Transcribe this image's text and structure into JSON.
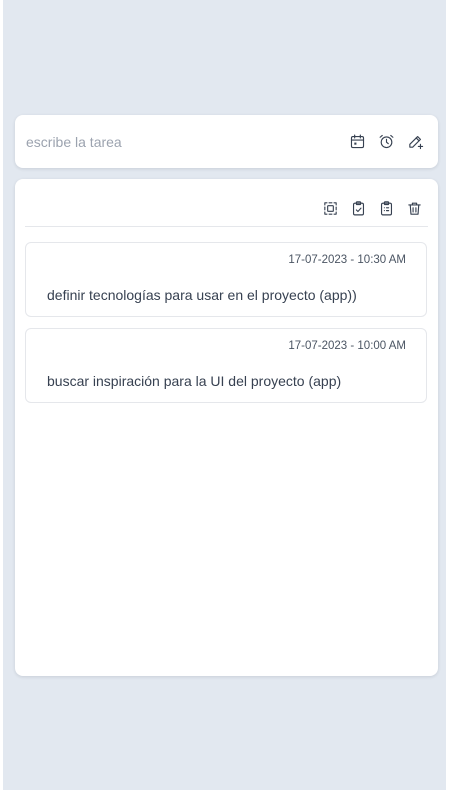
{
  "input": {
    "placeholder": "escribe la tarea",
    "value": "",
    "icons": [
      "calendar-icon",
      "alarm-clock-icon",
      "pen-plus-icon"
    ]
  },
  "toolbar": {
    "icons": [
      "select-all-icon",
      "clipboard-check-icon",
      "clipboard-list-icon",
      "trash-icon"
    ]
  },
  "tasks": [
    {
      "date": "17-07-2023 - 10:30 AM",
      "text": "definir tecnologías para usar en el proyecto (app))"
    },
    {
      "date": "17-07-2023 - 10:00 AM",
      "text": "buscar inspiración para la UI del proyecto (app)"
    }
  ],
  "colors": {
    "background": "#e2e8f0",
    "card": "#ffffff",
    "text": "#374151",
    "muted": "#9ca3af",
    "border": "#e5e7eb"
  }
}
